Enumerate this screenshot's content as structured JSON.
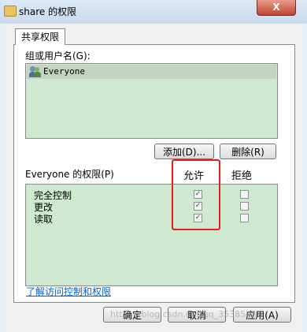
{
  "window": {
    "title": "share 的权限",
    "close_label": "X"
  },
  "tab": {
    "label": "共享权限"
  },
  "groups": {
    "label": "组或用户名(G):",
    "items": [
      {
        "name": "Everyone"
      }
    ]
  },
  "buttons": {
    "add": "添加(D)...",
    "remove": "删除(R)",
    "ok": "确定",
    "cancel": "取消",
    "apply": "应用(A)"
  },
  "permissions": {
    "header": "Everyone 的权限(P)",
    "allow_label": "允许",
    "deny_label": "拒绝",
    "rows": [
      {
        "name": "完全控制",
        "allow": true,
        "deny": false
      },
      {
        "name": "更改",
        "allow": true,
        "deny": false
      },
      {
        "name": "读取",
        "allow": true,
        "deny": false
      }
    ]
  },
  "link": "了解访问控制和权限",
  "watermark": "https://blog.csdn.net/qq_35385458"
}
